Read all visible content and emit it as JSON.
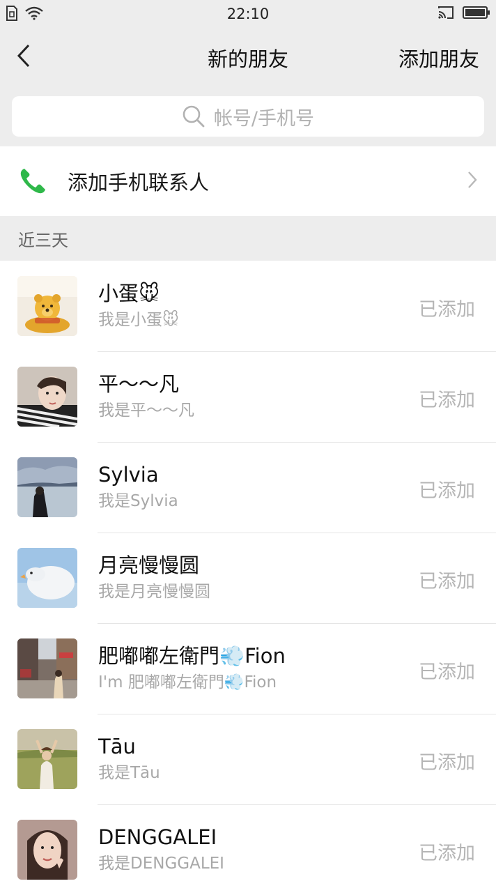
{
  "statusbar": {
    "time": "22:10"
  },
  "navbar": {
    "title": "新的朋友",
    "action": "添加朋友"
  },
  "search": {
    "placeholder": "帐号/手机号"
  },
  "phone_contacts": {
    "label": "添加手机联系人"
  },
  "section": {
    "title": "近三天"
  },
  "friends": [
    {
      "name": "小蛋🐭",
      "message": "我是小蛋🐭",
      "status": "已添加",
      "avatar_icon": "winnie-the-pooh-plush-avatar"
    },
    {
      "name": "平～～凡",
      "message": "我是平～～凡",
      "status": "已添加",
      "avatar_icon": "woman-selfie-avatar"
    },
    {
      "name": "Sylvia",
      "message": "我是Sylvia",
      "status": "已添加",
      "avatar_icon": "lake-silhouette-avatar"
    },
    {
      "name": "月亮慢慢圆",
      "message": "我是月亮慢慢圆",
      "status": "已添加",
      "avatar_icon": "white-goose-avatar"
    },
    {
      "name": "肥嘟嘟左衛門💨Fion",
      "message": "I'm 肥嘟嘟左衛門💨Fion",
      "status": "已添加",
      "avatar_icon": "street-photo-avatar"
    },
    {
      "name": "Tāu",
      "message": "我是Tāu",
      "status": "已添加",
      "avatar_icon": "field-girl-avatar"
    },
    {
      "name": "DENGGALEI",
      "message": "我是DENGGALEI",
      "status": "已添加",
      "avatar_icon": "woman-portrait-avatar"
    }
  ],
  "colors": {
    "background": "#ededed",
    "phone_icon": "#2fb84a",
    "status_text": "#b5b5b5"
  }
}
